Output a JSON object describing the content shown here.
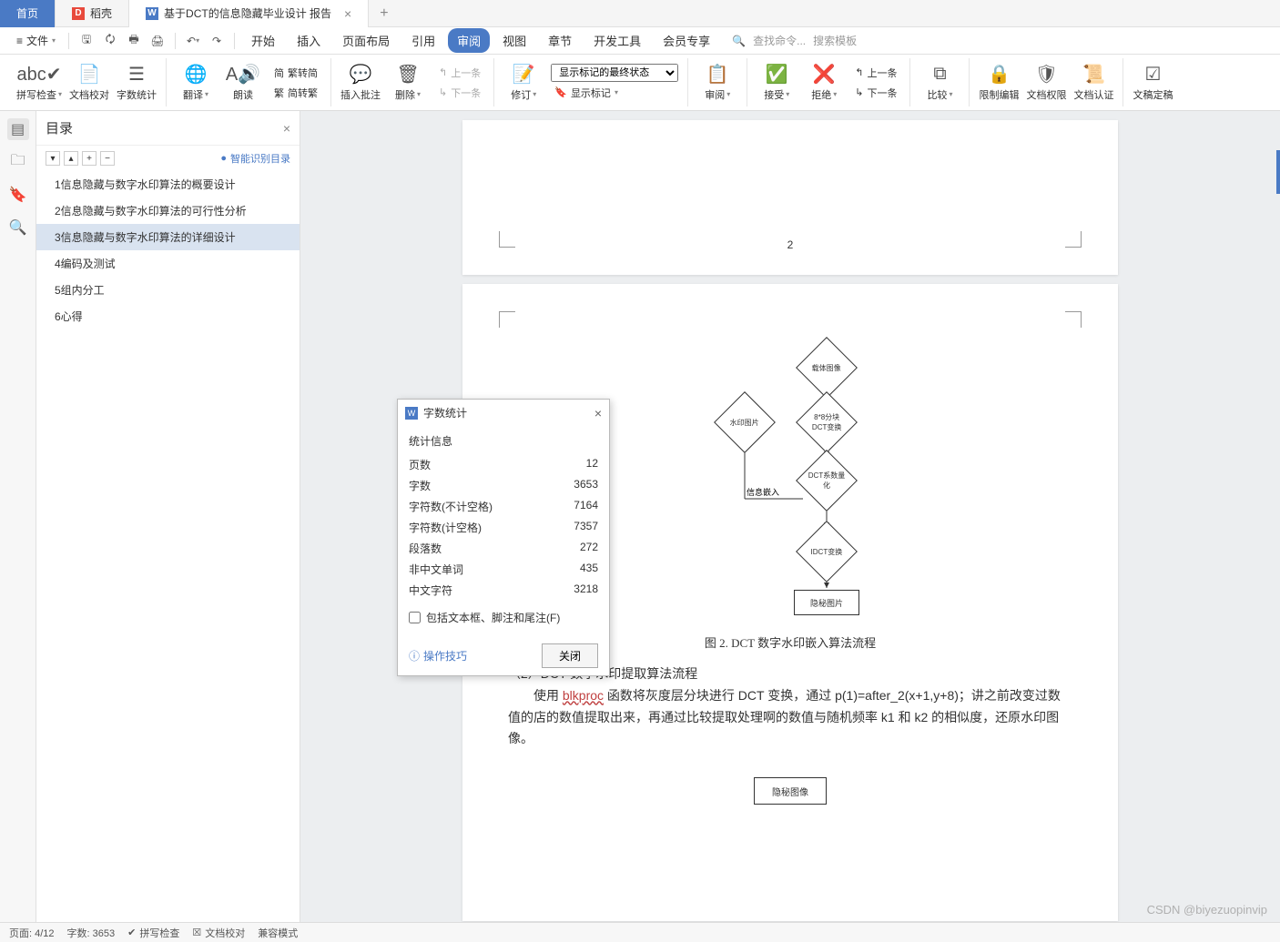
{
  "tabs": {
    "home": "首页",
    "second": "稻壳",
    "active": "基于DCT的信息隐藏毕业设计 报告"
  },
  "menubar": {
    "file": "文件",
    "items": [
      "开始",
      "插入",
      "页面布局",
      "引用",
      "审阅",
      "视图",
      "章节",
      "开发工具",
      "会员专享"
    ],
    "active_index": 4,
    "search_cmd": "查找命令...",
    "search_tpl": "搜索模板"
  },
  "ribbon": {
    "spell": "拼写检查",
    "proof": "文档校对",
    "wordcount": "字数统计",
    "translate": "翻译",
    "read": "朗读",
    "s2t": "繁转简",
    "t2s": "简转繁",
    "insert_comment": "插入批注",
    "delete": "删除",
    "prev_cm": "上一条",
    "next_cm": "下一条",
    "revise": "修订",
    "track_state": "显示标记的最终状态",
    "show_marks": "显示标记",
    "review": "审阅",
    "accept": "接受",
    "reject": "拒绝",
    "prev_ch": "上一条",
    "next_ch": "下一条",
    "compare": "比较",
    "restrict": "限制编辑",
    "docperm": "文档权限",
    "doccert": "文档认证",
    "docfinal": "文稿定稿"
  },
  "outline": {
    "title": "目录",
    "smart": "智能识别目录",
    "items": [
      "1信息隐藏与数字水印算法的概要设计",
      "2信息隐藏与数字水印算法的可行性分析",
      "3信息隐藏与数字水印算法的详细设计",
      "4编码及测试",
      "5组内分工",
      "6心得"
    ],
    "selected_index": 2
  },
  "doc": {
    "page_num_top": "2",
    "flow": {
      "node_carrier": "载体图像",
      "node_watermark": "水印图片",
      "node_split": "8*8分块\nDCT变换",
      "node_quant": "DCT系数量化",
      "node_embed": "信息嵌入",
      "node_idct": "IDCT变换",
      "node_secret": "隐秘图片"
    },
    "caption": "图 2. DCT 数字水印嵌入算法流程",
    "sub_heading": "（2）DCT 数字水印提取算法流程",
    "body_prefix": "使用 ",
    "body_blk": "blkproc",
    "body_rest": " 函数将灰度层分块进行 DCT 变换，通过 p(1)=after_2(x+1,y+8)；讲之前改变过数值的店的数值提取出来，再通过比较提取处理啊的数值与随机频率 k1 和 k2 的相似度，还原水印图像。",
    "box_bottom": "隐秘图像"
  },
  "dialog": {
    "title": "字数统计",
    "section": "统计信息",
    "rows": [
      {
        "label": "页数",
        "value": "12"
      },
      {
        "label": "字数",
        "value": "3653"
      },
      {
        "label": "字符数(不计空格)",
        "value": "7164"
      },
      {
        "label": "字符数(计空格)",
        "value": "7357"
      },
      {
        "label": "段落数",
        "value": "272"
      },
      {
        "label": "非中文单词",
        "value": "435"
      },
      {
        "label": "中文字符",
        "value": "3218"
      }
    ],
    "checkbox": "包括文本框、脚注和尾注(F)",
    "tips": "操作技巧",
    "close": "关闭"
  },
  "status": {
    "page": "页面: 4/12",
    "words": "字数: 3653",
    "spell": "拼写检查",
    "proof": "文档校对",
    "compat": "兼容模式"
  },
  "watermark": "CSDN @biyezuopinvip"
}
